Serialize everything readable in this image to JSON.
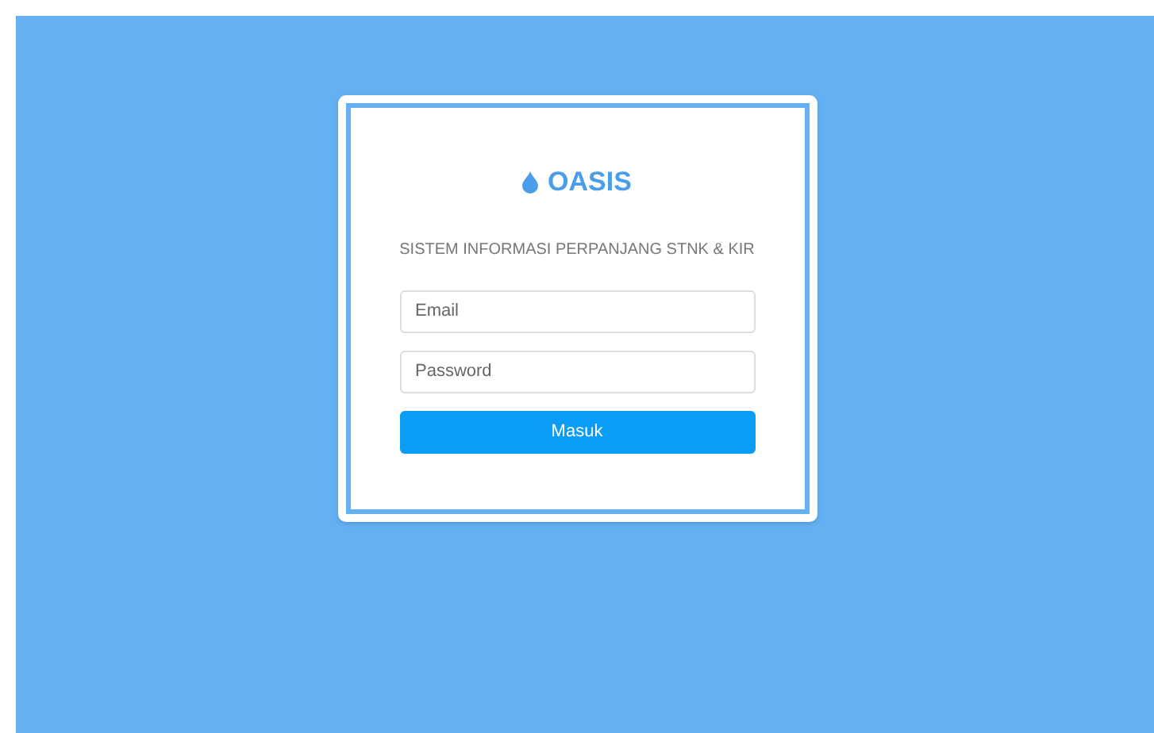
{
  "brand": {
    "name": "OASIS"
  },
  "subtitle": "SISTEM INFORMASI PERPANJANG STNK & KIR",
  "fields": [
    {
      "placeholder": "Email"
    },
    {
      "placeholder": "Password"
    }
  ],
  "button": "Masuk"
}
